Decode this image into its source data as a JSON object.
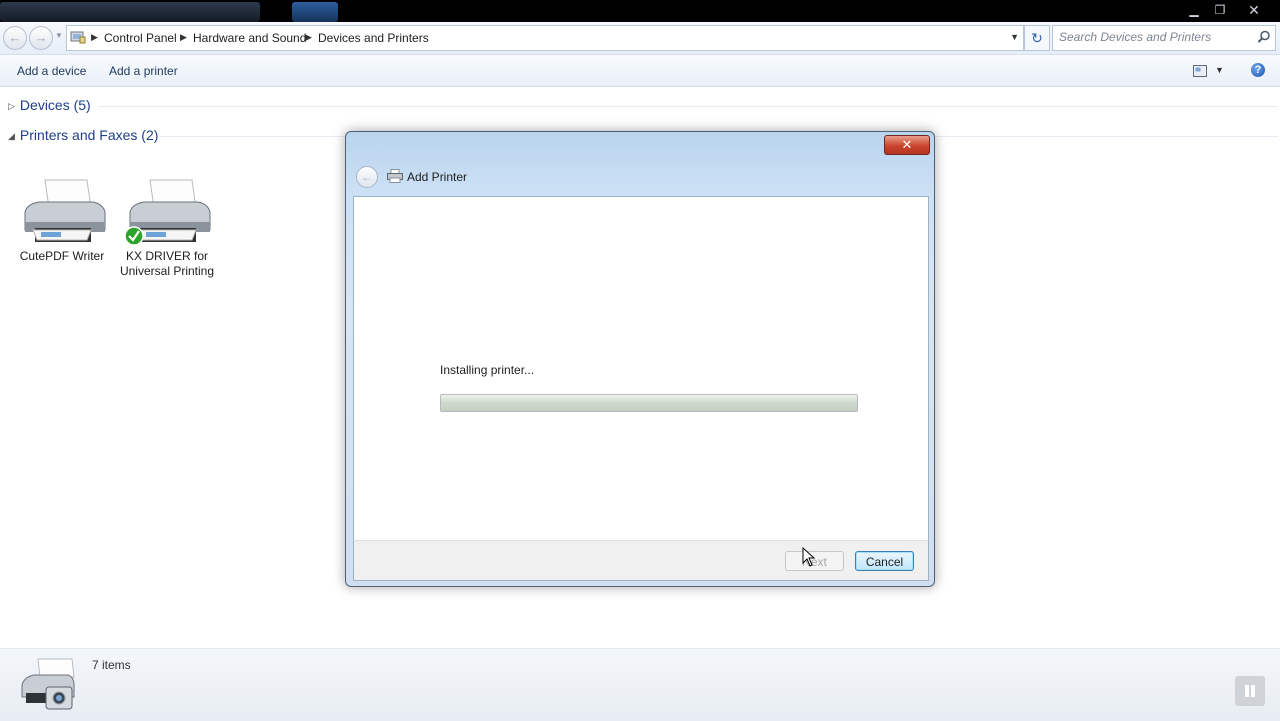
{
  "window": {
    "minimize_glyph": "▁",
    "maximize_glyph": "❐",
    "close_glyph": "✕"
  },
  "address_bar": {
    "breadcrumbs": [
      "Control Panel",
      "Hardware and Sound",
      "Devices and Printers"
    ],
    "search_placeholder": "Search Devices and Printers"
  },
  "command_bar": {
    "add_device": "Add a device",
    "add_printer": "Add a printer"
  },
  "groups": {
    "devices": "Devices (5)",
    "printers": "Printers and Faxes (2)"
  },
  "printers": [
    {
      "name": "CutePDF Writer",
      "default": false
    },
    {
      "name": "KX DRIVER for Universal Printing",
      "default": true
    }
  ],
  "status_bar": {
    "item_count": "7 items"
  },
  "dialog": {
    "title": "Add Printer",
    "close_glyph": "✕",
    "status_text": "Installing printer...",
    "progress_fraction": 1.0,
    "next_label": "Next",
    "cancel_label": "Cancel"
  },
  "colors": {
    "accent_link": "#1e3f8a",
    "close_red": "#c9442c",
    "default_check": "#2aa32a"
  }
}
